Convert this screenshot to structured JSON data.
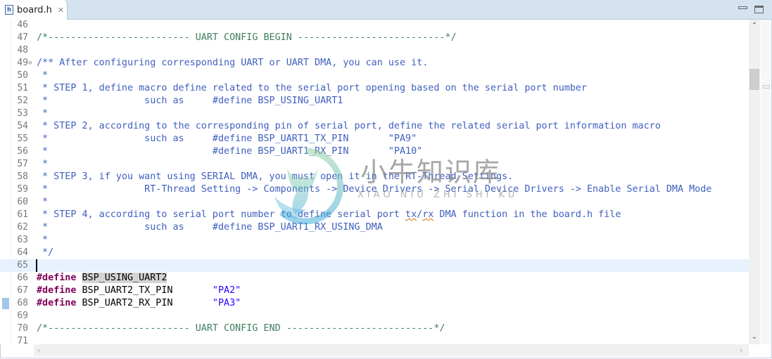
{
  "tab": {
    "filename": "board.h",
    "file_icon": "h-file-icon",
    "close_icon": "close-icon"
  },
  "window_controls": {
    "minimize": "minimize-icon",
    "maximize": "maximize-icon"
  },
  "editor": {
    "current_line": 65,
    "lines": [
      {
        "n": "46",
        "segs": []
      },
      {
        "n": "47",
        "segs": [
          {
            "c": "c-green",
            "t": "/*------------------------- UART CONFIG BEGIN --------------------------*/"
          }
        ]
      },
      {
        "n": "48",
        "segs": []
      },
      {
        "n": "49",
        "fold": true,
        "segs": [
          {
            "c": "c-doc",
            "t": "/** After configuring corresponding UART or UART DMA, you can use it."
          }
        ]
      },
      {
        "n": "50",
        "segs": [
          {
            "c": "c-doc",
            "t": " *"
          }
        ]
      },
      {
        "n": "51",
        "segs": [
          {
            "c": "c-doc",
            "t": " * STEP 1, define macro define related to the serial port opening based on the serial port number"
          }
        ]
      },
      {
        "n": "52",
        "segs": [
          {
            "c": "c-doc",
            "t": " *                 such as     #define BSP_USING_UART1"
          }
        ]
      },
      {
        "n": "53",
        "segs": [
          {
            "c": "c-doc",
            "t": " *"
          }
        ]
      },
      {
        "n": "54",
        "segs": [
          {
            "c": "c-doc",
            "t": " * STEP 2, according to the corresponding pin of serial port, define the related serial port information macro"
          }
        ]
      },
      {
        "n": "55",
        "segs": [
          {
            "c": "c-doc",
            "t": " *                 such as     #define BSP_UART1_TX_PIN       \"PA9\""
          }
        ]
      },
      {
        "n": "56",
        "segs": [
          {
            "c": "c-doc",
            "t": " *                             #define BSP_UART1_RX_PIN       \"PA10\""
          }
        ]
      },
      {
        "n": "57",
        "segs": [
          {
            "c": "c-doc",
            "t": " *"
          }
        ]
      },
      {
        "n": "58",
        "segs": [
          {
            "c": "c-doc",
            "t": " * STEP 3, if you want using SERIAL DMA, you must open it in the RT-Thread Settings."
          }
        ]
      },
      {
        "n": "59",
        "segs": [
          {
            "c": "c-doc",
            "t": " *                 RT-Thread Setting -> Components -> Device Drivers -> Serial Device Drivers -> Enable Serial DMA Mode"
          }
        ]
      },
      {
        "n": "60",
        "segs": [
          {
            "c": "c-doc",
            "t": " *"
          }
        ]
      },
      {
        "n": "61",
        "segs": [
          {
            "c": "c-doc",
            "t": " * STEP 4, according to serial port number to define serial port "
          },
          {
            "c": "c-doc squig",
            "t": "tx"
          },
          {
            "c": "c-doc",
            "t": "/"
          },
          {
            "c": "c-doc squig",
            "t": "rx"
          },
          {
            "c": "c-doc",
            "t": " DMA function in the board.h file"
          }
        ]
      },
      {
        "n": "62",
        "segs": [
          {
            "c": "c-doc",
            "t": " *                 such as     #define BSP_UART1_RX_USING_DMA"
          }
        ]
      },
      {
        "n": "63",
        "segs": [
          {
            "c": "c-doc",
            "t": " *"
          }
        ]
      },
      {
        "n": "64",
        "segs": [
          {
            "c": "c-doc",
            "t": " */"
          }
        ]
      },
      {
        "n": "65",
        "segs": []
      },
      {
        "n": "66",
        "segs": [
          {
            "c": "kw",
            "t": "#define"
          },
          {
            "c": "ident",
            "t": " "
          },
          {
            "c": "ident hl",
            "t": "BSP_USING_UART2"
          }
        ]
      },
      {
        "n": "67",
        "segs": [
          {
            "c": "kw",
            "t": "#define"
          },
          {
            "c": "ident",
            "t": " BSP_UART2_TX_PIN       "
          },
          {
            "c": "str",
            "t": "\"PA2\""
          }
        ]
      },
      {
        "n": "68",
        "marker": true,
        "segs": [
          {
            "c": "kw",
            "t": "#define"
          },
          {
            "c": "ident",
            "t": " BSP_UART2_RX_PIN       "
          },
          {
            "c": "str",
            "t": "\"PA3\""
          }
        ]
      },
      {
        "n": "69",
        "segs": []
      },
      {
        "n": "70",
        "segs": [
          {
            "c": "c-green",
            "t": "/*------------------------- UART CONFIG END --------------------------*/"
          }
        ]
      },
      {
        "n": "71",
        "segs": []
      }
    ]
  },
  "scrollbars": {
    "up": "▲",
    "down": "▼",
    "left": "<",
    "right": ">"
  },
  "watermark": {
    "chinese": "小牛知识库",
    "pinyin": "XIAO NIU ZHI SHI KU"
  }
}
